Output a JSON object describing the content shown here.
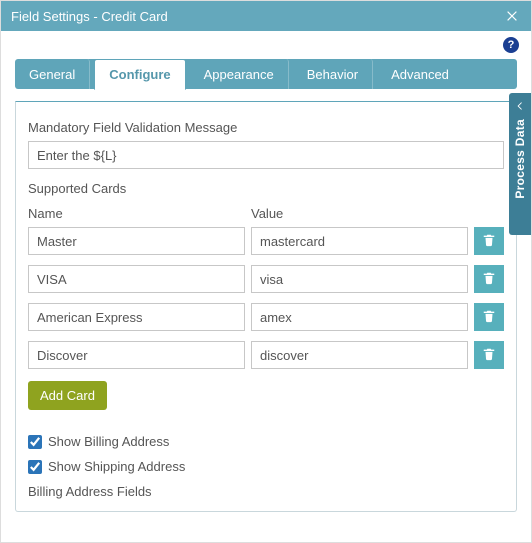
{
  "window": {
    "title": "Field Settings - Credit Card"
  },
  "tabs": [
    "General",
    "Configure",
    "Appearance",
    "Behavior",
    "Advanced"
  ],
  "active_tab": "Configure",
  "side_panel_label": "Process Data",
  "help_glyph": "?",
  "form": {
    "mandatory_label": "Mandatory Field Validation Message",
    "mandatory_value": "Enter the ${L}",
    "supported_cards_label": "Supported Cards",
    "col_name": "Name",
    "col_value": "Value",
    "cards": [
      {
        "name": "Master",
        "value": "mastercard"
      },
      {
        "name": "VISA",
        "value": "visa"
      },
      {
        "name": "American Express",
        "value": "amex"
      },
      {
        "name": "Discover",
        "value": "discover"
      }
    ],
    "add_card_label": "Add Card",
    "show_billing_label": "Show Billing Address",
    "show_billing_checked": true,
    "show_shipping_label": "Show Shipping Address",
    "show_shipping_checked": true,
    "billing_fields_label": "Billing Address Fields"
  }
}
